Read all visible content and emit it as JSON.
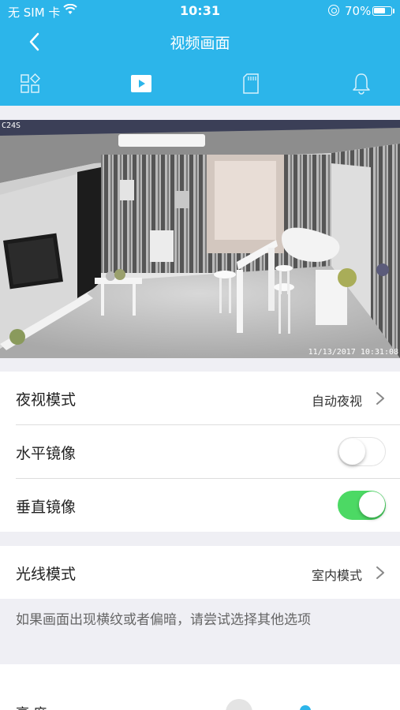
{
  "status_bar": {
    "carrier": "无 SIM 卡",
    "time": "10:31",
    "battery_text": "70%",
    "battery_level": 0.7
  },
  "nav": {
    "title": "视频画面",
    "back_icon": "chevron-left-icon"
  },
  "tabs": [
    {
      "icon": "grid-settings-icon",
      "active": false
    },
    {
      "icon": "play-video-icon",
      "active": true
    },
    {
      "icon": "sd-card-icon",
      "active": false
    },
    {
      "icon": "bell-icon",
      "active": false
    }
  ],
  "video": {
    "camera_tag": "C24S",
    "timestamp": "11/13/2017 10:31:08"
  },
  "settings": {
    "night_vision": {
      "label": "夜视模式",
      "value": "自动夜视"
    },
    "horizontal_mirror": {
      "label": "水平镜像",
      "enabled": false
    },
    "vertical_mirror": {
      "label": "垂直镜像",
      "enabled": true
    },
    "light_mode": {
      "label": "光线模式",
      "value": "室内模式"
    },
    "hint": "如果画面出现横纹或者偏暗，请尝试选择其他选项",
    "partial_label": "亮 度"
  },
  "colors": {
    "primary": "#2cb5ea",
    "toggle_on": "#4cd964",
    "background": "#efeff4"
  }
}
